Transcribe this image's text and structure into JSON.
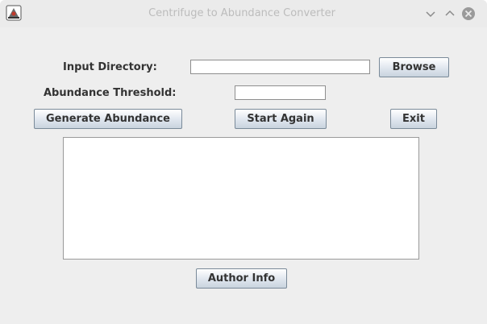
{
  "window": {
    "title": "Centrifuge to Abundance Converter",
    "app_icon": "java-app-icon",
    "controls": [
      "minimize-icon",
      "maximize-icon",
      "close-icon"
    ]
  },
  "form": {
    "input_directory_label": "Input Directory:",
    "input_directory_value": "",
    "browse_label": "Browse",
    "threshold_label": "Abundance Threshold:",
    "threshold_value": ""
  },
  "actions": {
    "generate_label": "Generate Abundance",
    "start_again_label": "Start Again",
    "exit_label": "Exit"
  },
  "output": {
    "text": ""
  },
  "footer": {
    "author_info_label": "Author Info"
  },
  "colors": {
    "window_bg": "#eeeeee",
    "title_text": "#bcbcbc",
    "button_border": "#7a8a99",
    "label_text": "#333333"
  }
}
